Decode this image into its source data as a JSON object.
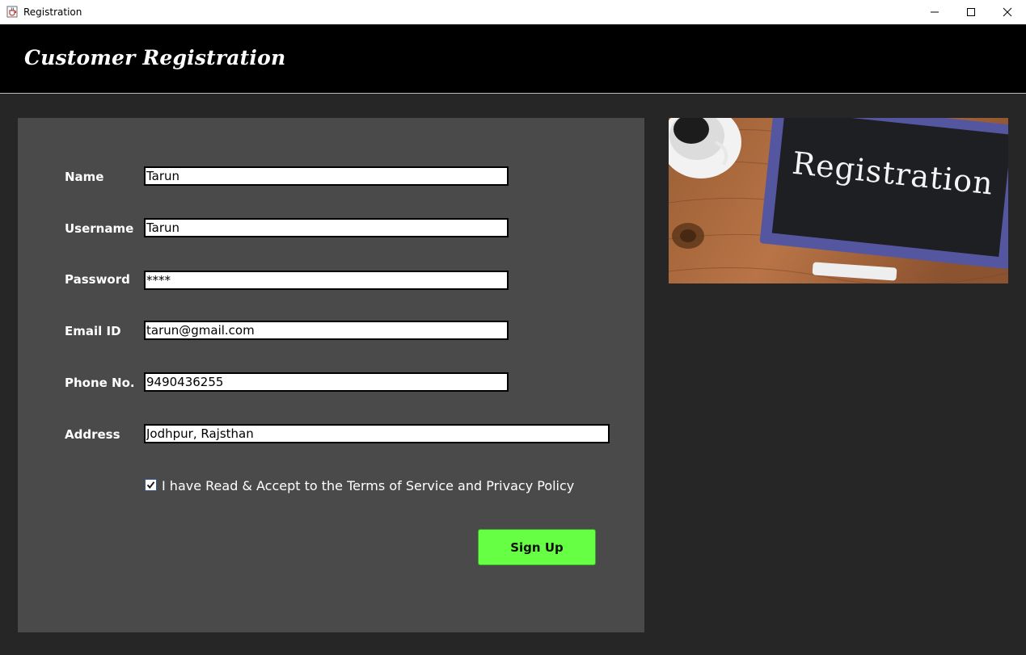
{
  "window": {
    "title": "Registration",
    "app_icon": "java-cup-icon",
    "controls": [
      "minimize-icon",
      "maximize-icon",
      "close-icon"
    ]
  },
  "header": {
    "heading": "Customer Registration"
  },
  "form": {
    "fields": [
      {
        "label": "Name",
        "value": "Tarun"
      },
      {
        "label": "Username",
        "value": "Tarun"
      },
      {
        "label": "Password",
        "value": "****"
      },
      {
        "label": "Email ID",
        "value": "tarun@gmail.com"
      },
      {
        "label": "Phone No.",
        "value": "9490436255"
      },
      {
        "label": "Address",
        "value": "Jodhpur, Rajsthan"
      }
    ],
    "terms_checked": true,
    "terms_label": "I have Read & Accept to the Terms of Service and Privacy Policy",
    "signup_label": "Sign Up"
  },
  "image": {
    "chalkboard_text": "Registration"
  },
  "colors": {
    "background": "#262626",
    "header": "#000000",
    "panel": "#4a4a4a",
    "signup_button": "#66ff44"
  }
}
